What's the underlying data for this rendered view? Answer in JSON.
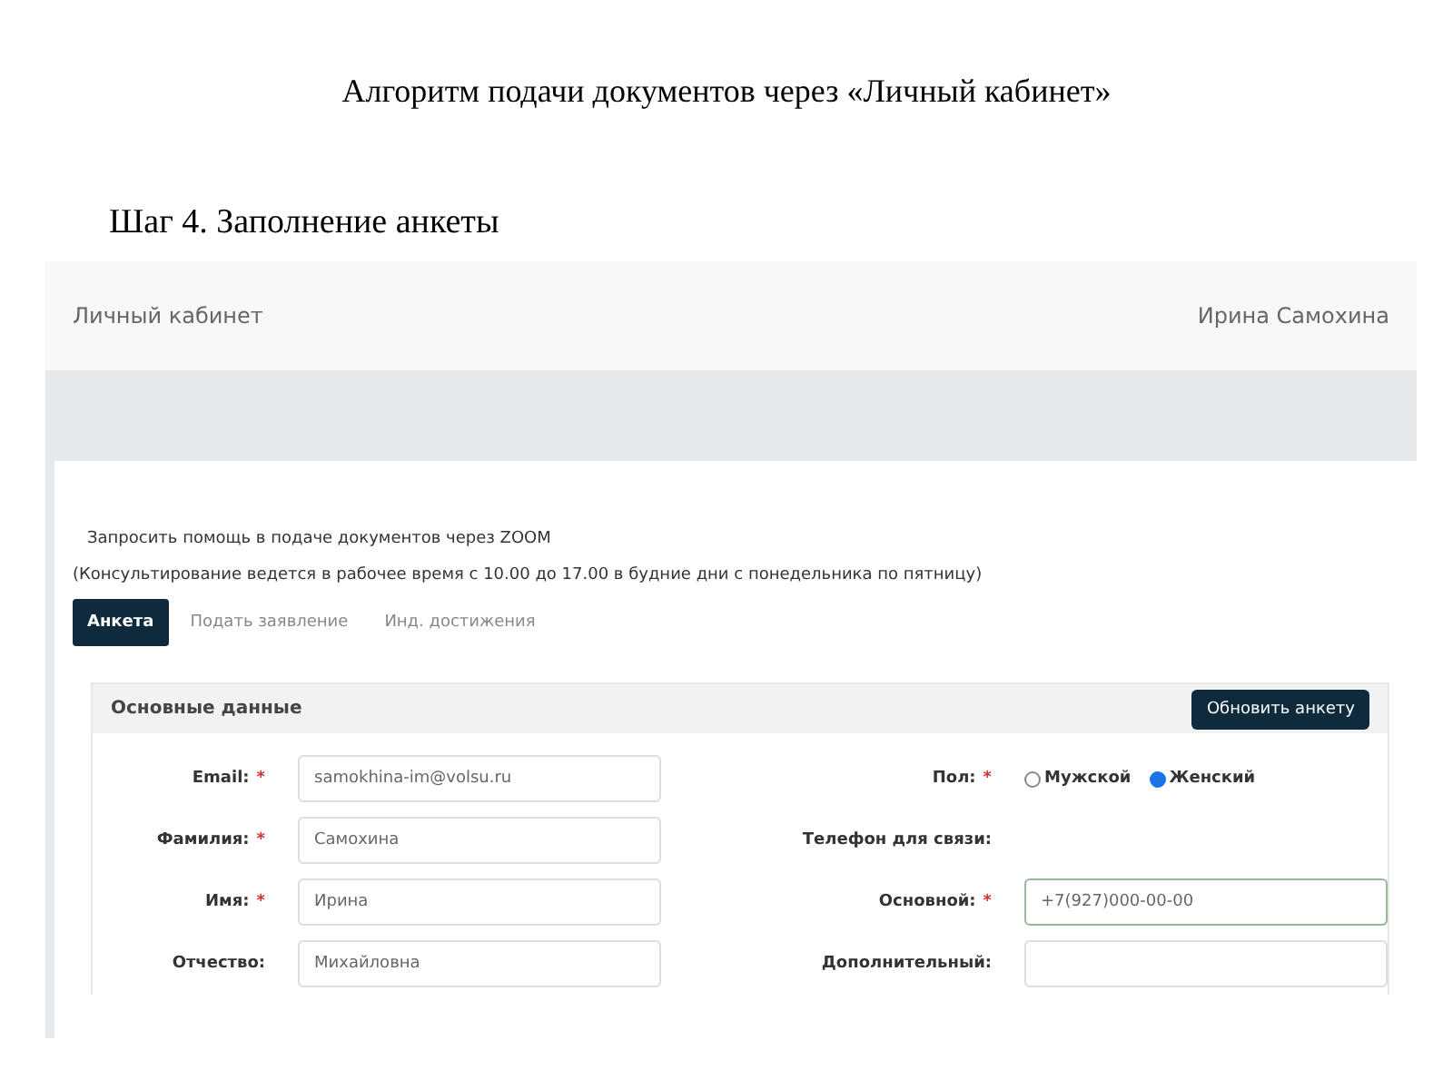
{
  "slide": {
    "title": "Алгоритм подачи документов через «Личный кабинет»",
    "subtitle": "Шаг 4. Заполнение анкеты"
  },
  "screenshot": {
    "header": {
      "brand": "Личный кабинет",
      "user": "Ирина Самохина"
    },
    "help_link": "Запросить помощь в подаче документов через ZOOM",
    "note": "(Консультирование ведется в рабочее время с 10.00 до 17.00 в будние дни с понедельника по пятницу)",
    "tabs": [
      {
        "label": "Анкета",
        "selected": true
      },
      {
        "label": "Подать заявление",
        "selected": false
      },
      {
        "label": "Инд. достижения",
        "selected": false
      }
    ],
    "section": {
      "title": "Основные данные",
      "button": "Обновить анкету",
      "left_fields": [
        {
          "label": "Email:",
          "required_mark": "*",
          "value": "samokhina-im@volsu.ru"
        },
        {
          "label": "Фамилия:",
          "required_mark": "*",
          "value": "Самохина"
        },
        {
          "label": "Имя:",
          "required_mark": "*",
          "value": "Ирина"
        },
        {
          "label": "Отчество:",
          "value": "Михайловна"
        }
      ],
      "gender": {
        "label": "Пол:",
        "required_mark": "*",
        "options": [
          {
            "label": "Мужской",
            "selected": false
          },
          {
            "label": "Женский",
            "selected": true
          }
        ]
      },
      "phone_heading": "Телефон для связи:",
      "phone_fields": [
        {
          "label": "Основной:",
          "required_mark": "*",
          "value": "+7(927)000-00-00",
          "focused": true
        },
        {
          "label": "Дополнительный:",
          "focused": false
        }
      ]
    }
  }
}
